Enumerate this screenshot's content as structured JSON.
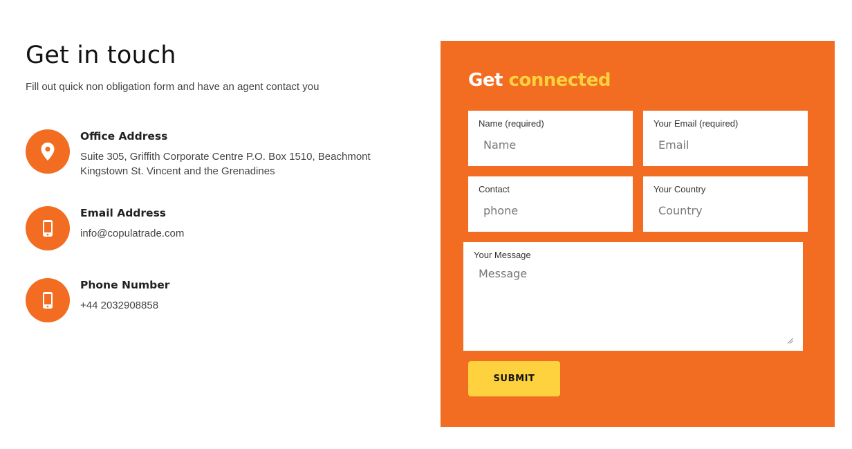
{
  "contact": {
    "heading": "Get in touch",
    "subtitle": "Fill out quick non obligation form and have an agent contact you",
    "items": [
      {
        "icon": "location-pin-icon",
        "title": "Office Address",
        "lines": [
          "Suite 305, Griffith Corporate Centre P.O. Box 1510, Beachmont",
          "Kingstown St. Vincent and the Grenadines"
        ]
      },
      {
        "icon": "mobile-phone-icon",
        "title": "Email Address",
        "lines": [
          "info@copulatrade.com"
        ]
      },
      {
        "icon": "mobile-phone-icon",
        "title": "Phone Number",
        "lines": [
          "+44 2032908858"
        ]
      }
    ],
    "accent_color": "#f26d21"
  },
  "form": {
    "title_white": "Get",
    "title_yellow": "connected",
    "panel_color": "#f26d21",
    "highlight_color": "#fdd23e",
    "fields": {
      "name": {
        "label": "Name (required)",
        "placeholder": "Name",
        "value": ""
      },
      "email": {
        "label": "Your Email (required)",
        "placeholder": "Email",
        "value": ""
      },
      "contact": {
        "label": "Contact",
        "placeholder": "phone",
        "value": ""
      },
      "country": {
        "label": "Your Country",
        "placeholder": "Country",
        "value": ""
      },
      "message": {
        "label": "Your Message",
        "placeholder": "Message",
        "value": ""
      }
    },
    "submit_label": "SUBMIT"
  }
}
